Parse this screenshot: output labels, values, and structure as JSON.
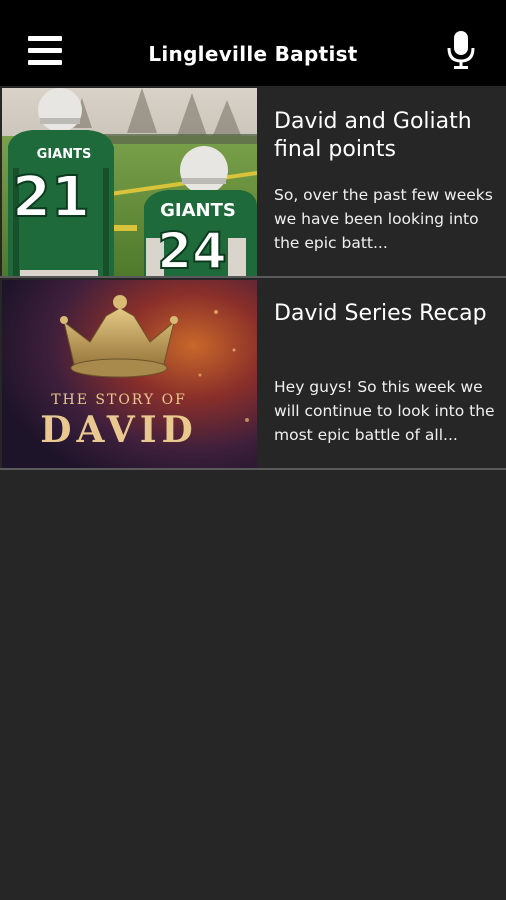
{
  "header": {
    "title": "Lingleville Baptist",
    "menu_icon": "hamburger-menu-icon",
    "mic_icon": "microphone-icon"
  },
  "posts": [
    {
      "title": "David and Goliath final points",
      "excerpt": "So, over the past few weeks we have been looking into the epic batt...",
      "image": "football-players-giants-photo",
      "image_text": {
        "team": "GIANTS",
        "number_left": "21",
        "number_right": "24"
      }
    },
    {
      "title": "David Series Recap",
      "excerpt": "Hey guys! So this week we will continue to look into the most epic battle of all...",
      "image": "story-of-david-crown-artwork",
      "image_text": {
        "line1": "THE STORY OF",
        "line2": "DAVID"
      }
    }
  ],
  "colors": {
    "appbar": "#000000",
    "background": "#262626",
    "separator": "#5a5a5a",
    "text": "#ffffff"
  }
}
